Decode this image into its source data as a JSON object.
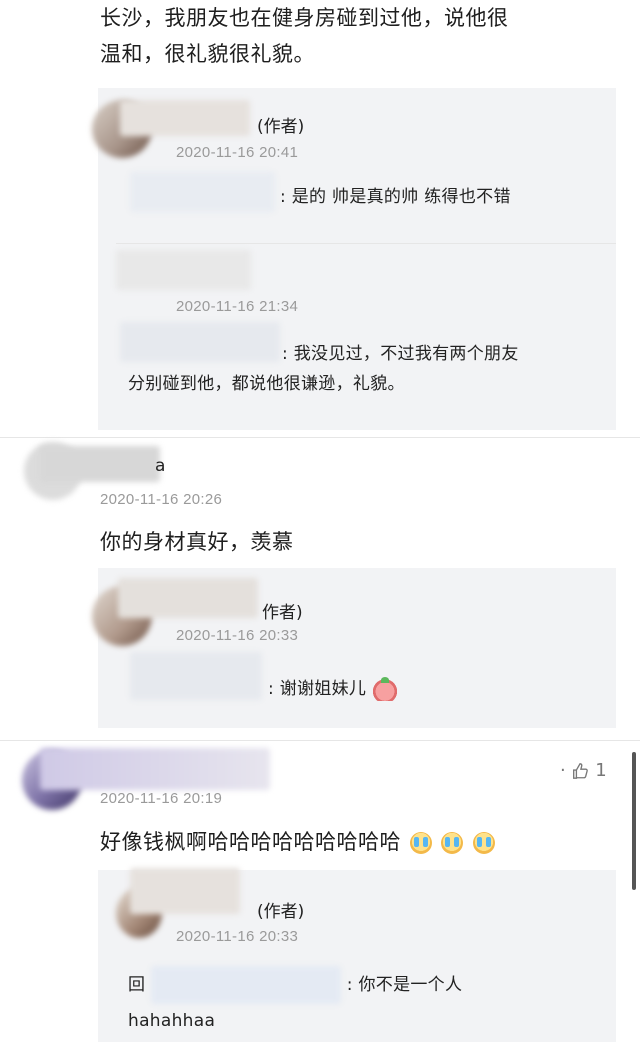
{
  "intro_line_1": "长沙，我朋友也在健身房碰到过他，说他很",
  "intro_line_2": "温和，很礼貌很礼貌。",
  "thread1": {
    "reply1": {
      "author_tag": "(作者)",
      "time": "2020-11-16 20:41",
      "text": ": 是的 帅是真的帅 练得也不错"
    },
    "reply2": {
      "time": "2020-11-16 21:34",
      "text_1": ": 我没见过，不过我有两个朋友",
      "text_2": "分别碰到他，都说他很谦逊，礼貌。"
    }
  },
  "comment2": {
    "user_suffix": "a",
    "time": "2020-11-16 20:26",
    "text": "你的身材真好，羡慕",
    "reply": {
      "author_tag": "作者)",
      "time": "2020-11-16 20:33",
      "text": ": 谢谢姐妹儿"
    }
  },
  "comment3": {
    "time": "2020-11-16 20:19",
    "text": "好像钱枫啊哈哈哈哈哈哈哈哈哈",
    "like_count": "1",
    "like_prefix": "·",
    "emojis": [
      "crying-laughing-emoji",
      "crying-laughing-emoji",
      "crying-laughing-emoji"
    ],
    "reply": {
      "author_tag": "(作者)",
      "time": "2020-11-16 20:33",
      "reply_prefix": "回",
      "text_1": ": 你不是一个人",
      "text_2": "hahahhaa"
    }
  },
  "colors": {
    "panel": "#f2f3f5",
    "meta": "#9a9a9a",
    "text": "#1e1e1e"
  }
}
